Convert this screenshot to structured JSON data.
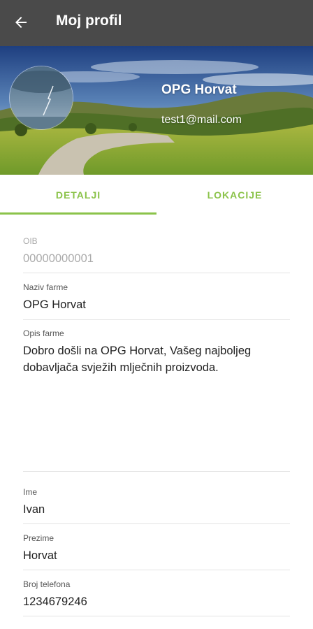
{
  "appbar": {
    "title": "Moj profil",
    "back_icon": "arrow-back-icon"
  },
  "profile": {
    "name": "OPG Horvat",
    "email": "test1@mail.com"
  },
  "tabs": [
    {
      "label": "DETALJI",
      "selected": true
    },
    {
      "label": "LOKACIJE",
      "selected": false
    }
  ],
  "fields": {
    "oib": {
      "label": "OIB",
      "value": "00000000001"
    },
    "farm_name": {
      "label": "Naziv farme",
      "value": "OPG Horvat"
    },
    "farm_description": {
      "label": "Opis farme",
      "value": "Dobro došli na OPG Horvat, Vašeg najboljeg dobavljača svježih mlječnih proizvoda."
    },
    "first_name": {
      "label": "Ime",
      "value": "Ivan"
    },
    "last_name": {
      "label": "Prezime",
      "value": "Horvat"
    },
    "phone": {
      "label": "Broj telefona",
      "value": "1234679246"
    }
  },
  "colors": {
    "appbar": "#4a4a4a",
    "accent": "#8bc34a"
  }
}
